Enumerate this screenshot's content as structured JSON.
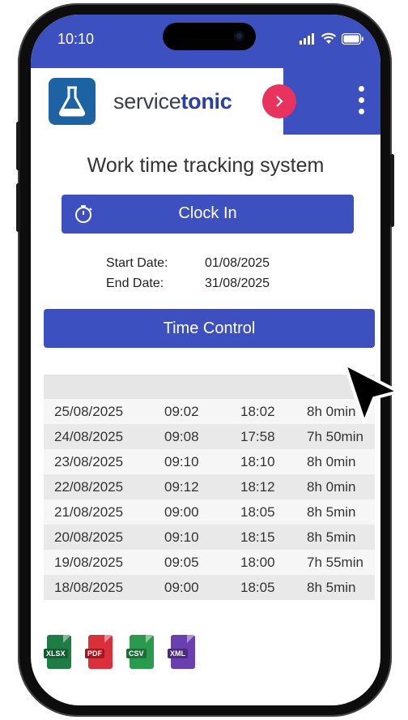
{
  "status_bar": {
    "time": "10:10"
  },
  "header": {
    "brand_regular": "service",
    "brand_bold": "tonic",
    "go_icon": "chevron-right-icon",
    "menu_icon": "more-vertical-icon",
    "logo_icon": "flask-icon"
  },
  "main": {
    "title": "Work time tracking system",
    "clock_in_label": "Clock In",
    "clock_icon": "stopwatch-icon",
    "start_date_label": "Start Date:",
    "start_date_value": "01/08/2025",
    "end_date_label": "End Date:",
    "end_date_value": "31/08/2025",
    "time_control_label": "Time Control"
  },
  "table": {
    "rows": [
      {
        "date": "25/08/2025",
        "in": "09:02",
        "out": "18:02",
        "total": "8h 0min"
      },
      {
        "date": "24/08/2025",
        "in": "09:08",
        "out": "17:58",
        "total": "7h 50min"
      },
      {
        "date": "23/08/2025",
        "in": "09:10",
        "out": "18:10",
        "total": "8h 0min"
      },
      {
        "date": "22/08/2025",
        "in": "09:12",
        "out": "18:12",
        "total": "8h 0min"
      },
      {
        "date": "21/08/2025",
        "in": "09:00",
        "out": "18:05",
        "total": "8h 5min"
      },
      {
        "date": "20/08/2025",
        "in": "09:10",
        "out": "18:15",
        "total": "8h 5min"
      },
      {
        "date": "19/08/2025",
        "in": "09:05",
        "out": "18:00",
        "total": "7h 55min"
      },
      {
        "date": "18/08/2025",
        "in": "09:00",
        "out": "18:05",
        "total": "8h 5min"
      }
    ]
  },
  "exports": [
    {
      "label": "XLSX",
      "color": "#1e7d45",
      "tag_color": "#145c31"
    },
    {
      "label": "PDF",
      "color": "#d9303b",
      "tag_color": "#a9151f"
    },
    {
      "label": "CSV",
      "color": "#2a9a4d",
      "tag_color": "#1c6e35"
    },
    {
      "label": "XML",
      "color": "#6a3fb0",
      "tag_color": "#4b2a85"
    }
  ],
  "colors": {
    "accent": "#3c50c0",
    "pink": "#e8335f"
  }
}
